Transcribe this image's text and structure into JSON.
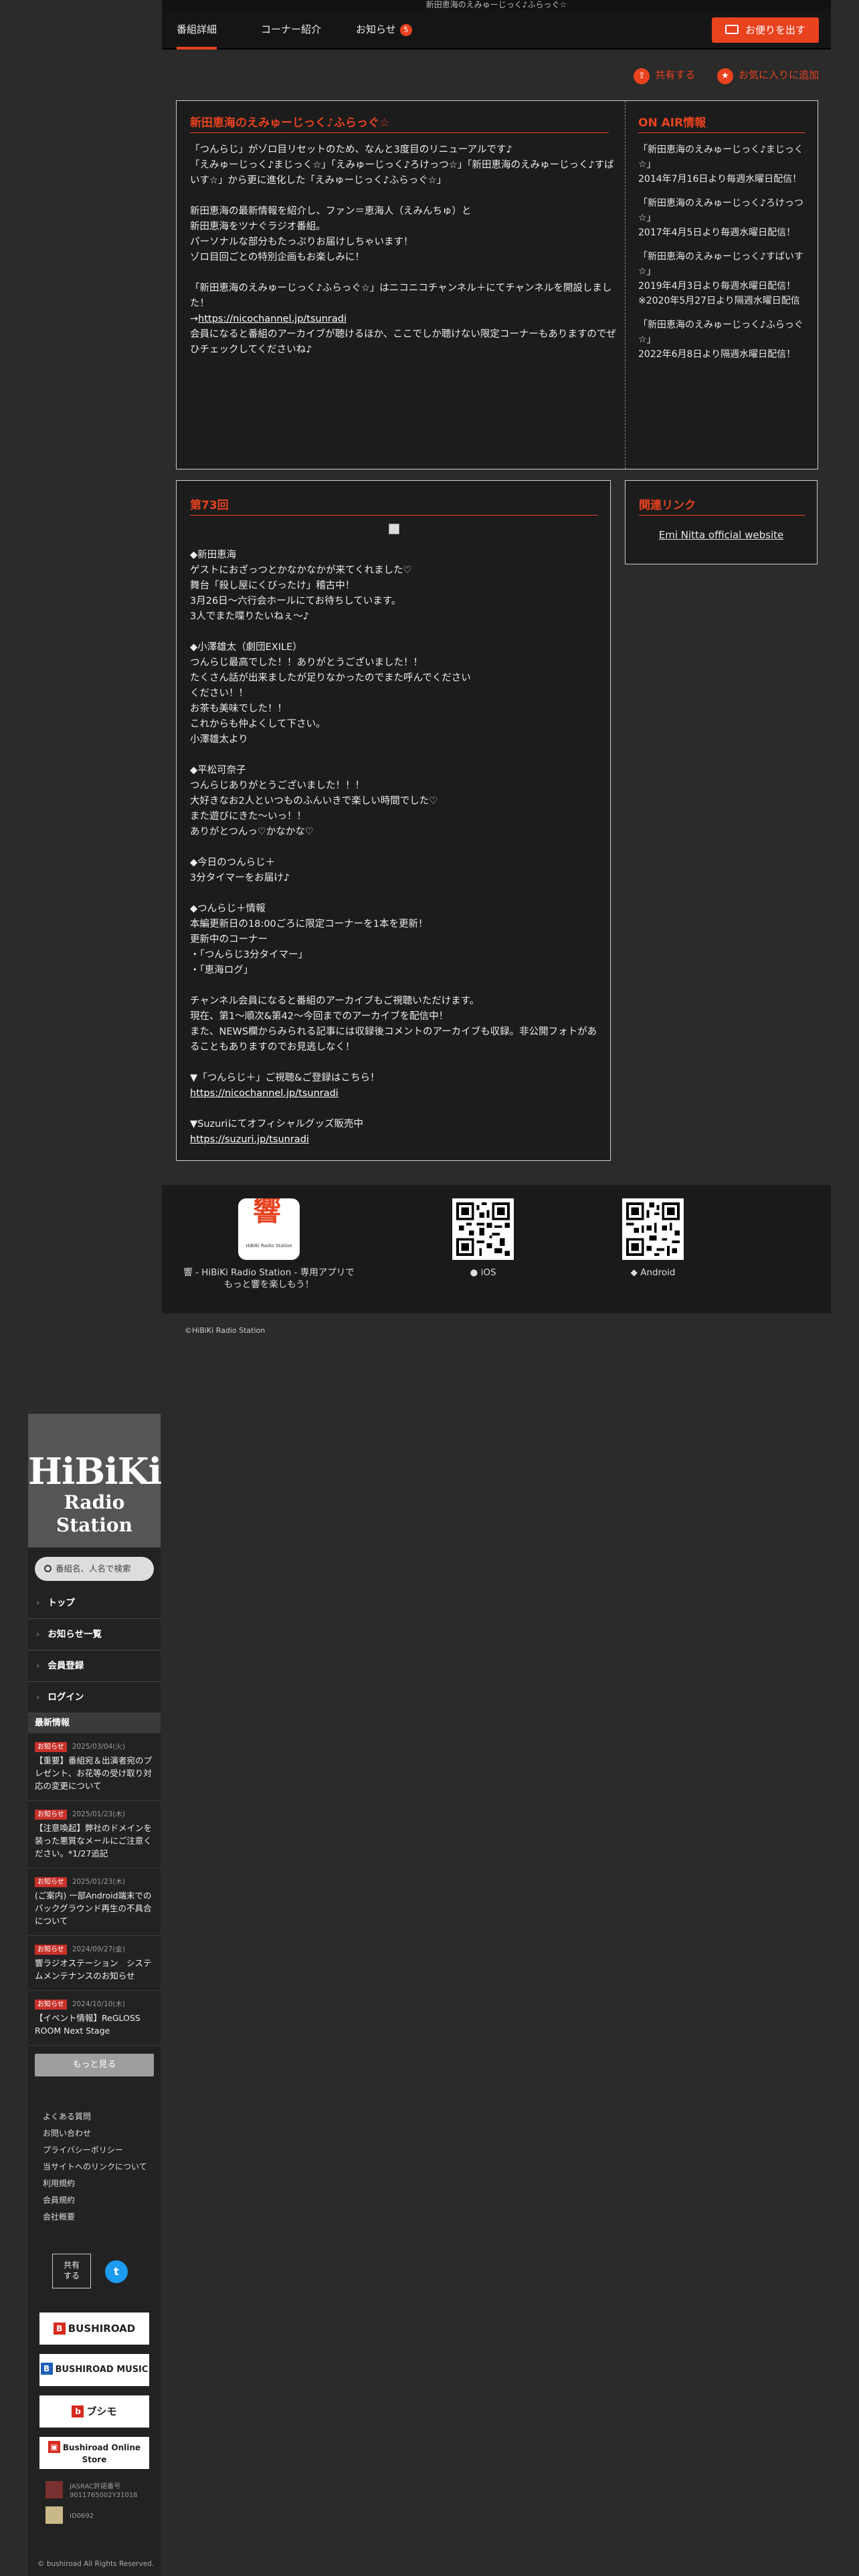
{
  "banner_alt": "新田恵海のえみゅーじっく♪ふらっぐ☆",
  "tabs": [
    {
      "label": "番組詳細"
    },
    {
      "label": "コーナー紹介"
    },
    {
      "label": "お知らせ",
      "badge": "5"
    }
  ],
  "mail_button": "お便りを出す",
  "actions": {
    "share": "共有する",
    "favorite": "お気に入りに追加"
  },
  "intro": {
    "title": "新田恵海のえみゅーじっく♪ふらっぐ☆",
    "desc_pre": "「つんらじ」がゾロ目リセットのため、なんと3度目のリニューアルです♪\n「えみゅーじっく♪まじっく☆」「えみゅーじっく♪ろけっつ☆」「新田恵海のえみゅーじっく♪すばいす☆」から更に進化した「えみゅーじっく♪ふらっぐ☆」\n\n新田恵海の最新情報を紹介し、ファン＝恵海人（えみんちゅ）と\n新田恵海をツナぐラジオ番組。\nパーソナルな部分もたっぷりお届けしちゃいます！\nゾロ目回ごとの特別企画もお楽しみに！\n\n「新田恵海のえみゅーじっく♪ふらっぐ☆」はニコニコチャンネル＋にてチャンネルを開設しました！\n→",
    "link": "https://nicochannel.jp/tsunradi",
    "desc_post": "\n会員になると番組のアーカイブが聴けるほか、ここでしか聴けない限定コーナーもありますのでぜひチェックしてくださいね♪"
  },
  "onair": {
    "title": "ON AIR情報",
    "items": [
      "「新田恵海のえみゅーじっく♪まじっく☆」\n2014年7月16日より毎週水曜日配信！",
      "「新田恵海のえみゅーじっく♪ろけっつ☆」\n2017年4月5日より毎週水曜日配信！",
      "「新田恵海のえみゅーじっく♪すばいす☆」\n2019年4月3日より毎週水曜日配信！\n※2020年5月27日より隔週水曜日配信",
      "「新田恵海のえみゅーじっく♪ふらっぐ☆」\n2022年6月8日より隔週水曜日配信！"
    ]
  },
  "episode": {
    "title": "第73回",
    "body_1": "◆新田恵海\nゲストにおざっつとかなかなかが来てくれました♡\n舞台「殺し屋にくびったけ」稽古中！\n3月26日〜六行会ホールにてお待ちしています。\n3人でまた喋りたいねぇ〜♪\n\n◆小澤雄太（劇団EXILE）\nつんらじ最高でした！！ありがとうございました！！\nたくさん話が出来ましたが足りなかったのでまた呼んでください\nください！！\nお茶も美味でした！！\nこれからも仲よくして下さい。\n小澤雄太より\n\n◆平松可奈子\nつんらじありがとうございました！！！\n大好きなお2人といつものふんいきで楽しい時間でした♡\nまた遊びにきた〜いっ！！\nありがとつんっ♡かなかな♡\n\n◆今日のつんらじ＋\n3分タイマーをお届け♪\n\n◆つんらじ＋情報\n本編更新日の18:00ごろに限定コーナーを1本を更新！\n更新中のコーナー\n・「つんらじ3分タイマー」\n・「恵海ログ」\n\nチャンネル会員になると番組のアーカイブもご視聴いただけます。\n現在、第1〜順次&第42〜今回までのアーカイブを配信中！\nまた、NEWS欄からみられる記事には収録後コメントのアーカイブも収録。非公開フォトがあることもありますのでお見逃しなく！\n\n▼「つんらじ＋」ご視聴&ご登録はこちら！\n",
    "link_1": "https://nicochannel.jp/tsunradi",
    "body_2": "\n\n▼Suzuriにてオフィシャルグッズ販売中\n",
    "link_2": "https://suzuri.jp/tsunradi"
  },
  "links": {
    "title": "関連リンク",
    "item": "Emi Nitta official website"
  },
  "apps": {
    "hibiki_caption": "響 - HiBiKi Radio Station - 専用アプリで\nもっと響を楽しもう！",
    "ios": "iOS",
    "android": "Android",
    "icon_glyph": "響",
    "icon_sub": "HiBiKi Radio Station"
  },
  "copyright_main": "©HiBiKi Radio Station",
  "sidebar": {
    "logo_1": "HiBiKi",
    "logo_2": "Radio Station",
    "search_placeholder": "番組名、人名で検索",
    "nav": [
      "トップ",
      "お知らせ一覧",
      "会員登録",
      "ログイン"
    ],
    "news_title": "最新情報",
    "news": [
      {
        "tag": "お知らせ",
        "date": "2025/03/04(火)",
        "text": "【重要】番組宛＆出演者宛のプレゼント、お花等の受け取り対応の変更について"
      },
      {
        "tag": "お知らせ",
        "date": "2025/01/23(木)",
        "text": "【注意喚起】弊社のドメインを装った悪質なメールにご注意ください。*1/27追記"
      },
      {
        "tag": "お知らせ",
        "date": "2025/01/23(木)",
        "text": "(ご案内) 一部Android端末でのバックグラウンド再生の不具合について"
      },
      {
        "tag": "お知らせ",
        "date": "2024/09/27(金)",
        "text": "響ラジオステーション　システムメンテナンスのお知らせ"
      },
      {
        "tag": "お知らせ",
        "date": "2024/10/10(木)",
        "text": "【イベント情報】ReGLOSS ROOM Next Stage"
      }
    ],
    "more": "もっと見る",
    "sublinks": [
      "よくある質問",
      "お問い合わせ",
      "プライバシーポリシー",
      "当サイトへのリンクについて",
      "利用規約",
      "会員規約",
      "会社概要"
    ],
    "share": "共有\nする",
    "twitter": "t",
    "partners": [
      "BUSHIROAD",
      "BUSHIROAD MUSIC",
      "ブシモ",
      "Bushiroad Online Store"
    ],
    "jasrac": "JASRAC許諾番号\n9011765002Y31018",
    "nextone": "ID0692",
    "copyright": "© bushiroad All Rights Reserved."
  }
}
